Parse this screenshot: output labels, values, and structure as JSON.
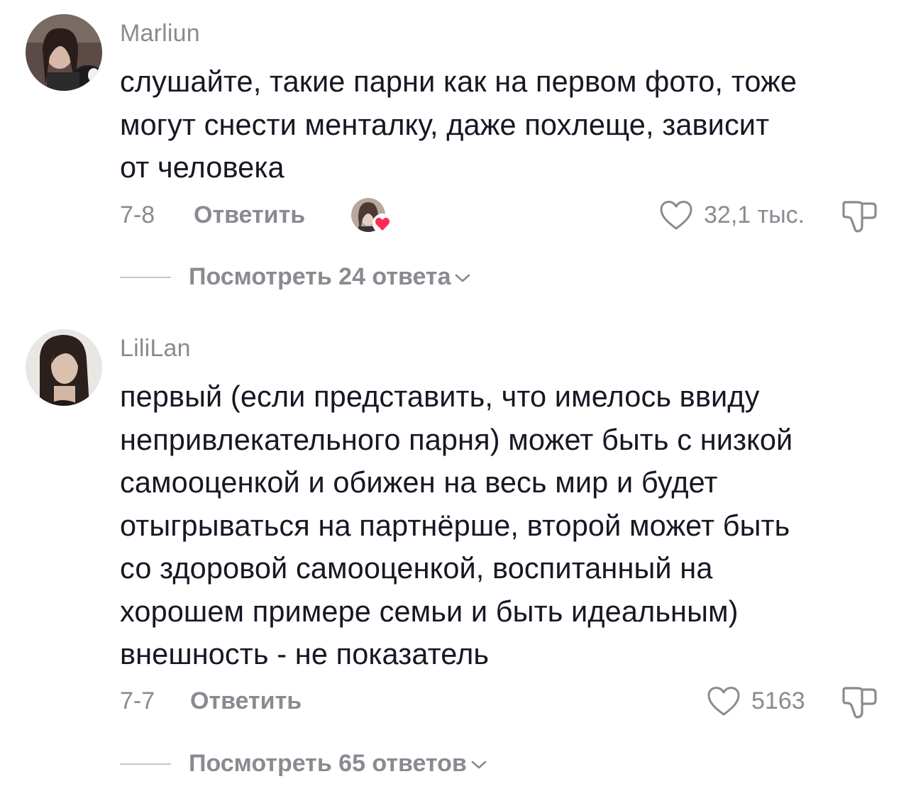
{
  "comments": [
    {
      "username": "Marliun",
      "text_lines": [
        "слушайте, такие парни как на первом фото, тоже",
        "могут снести менталку, даже похлеще, зависит",
        "от человека"
      ],
      "date": "7-8",
      "reply_label": "Ответить",
      "like_count": "32,1 тыс.",
      "view_replies": "Посмотреть 24 ответа"
    },
    {
      "username": "LiliLan",
      "text_lines": [
        "первый (если представить, что имелось ввиду",
        "непривлекательного парня) может быть с низкой",
        "самооценкой и обижен на весь мир и будет",
        "отыгрываться на партнёрше, второй может быть",
        "со здоровой самооценкой, воспитанный на",
        "хорошем примере семьи и быть идеальным)",
        "внешность - не показатель"
      ],
      "date": "7-7",
      "reply_label": "Ответить",
      "like_count": "5163",
      "view_replies": "Посмотреть 65 ответов"
    }
  ],
  "icons": {
    "like": "heart-outline-icon",
    "dislike": "thumbs-down-outline-icon",
    "chevron": "chevron-down-icon",
    "creator_liked": "creator-liked-heart-badge"
  },
  "colors": {
    "text": "#161823",
    "secondary": "#8a8b91",
    "divider": "#c5c6c9",
    "heart_badge": "#fe2c55"
  }
}
